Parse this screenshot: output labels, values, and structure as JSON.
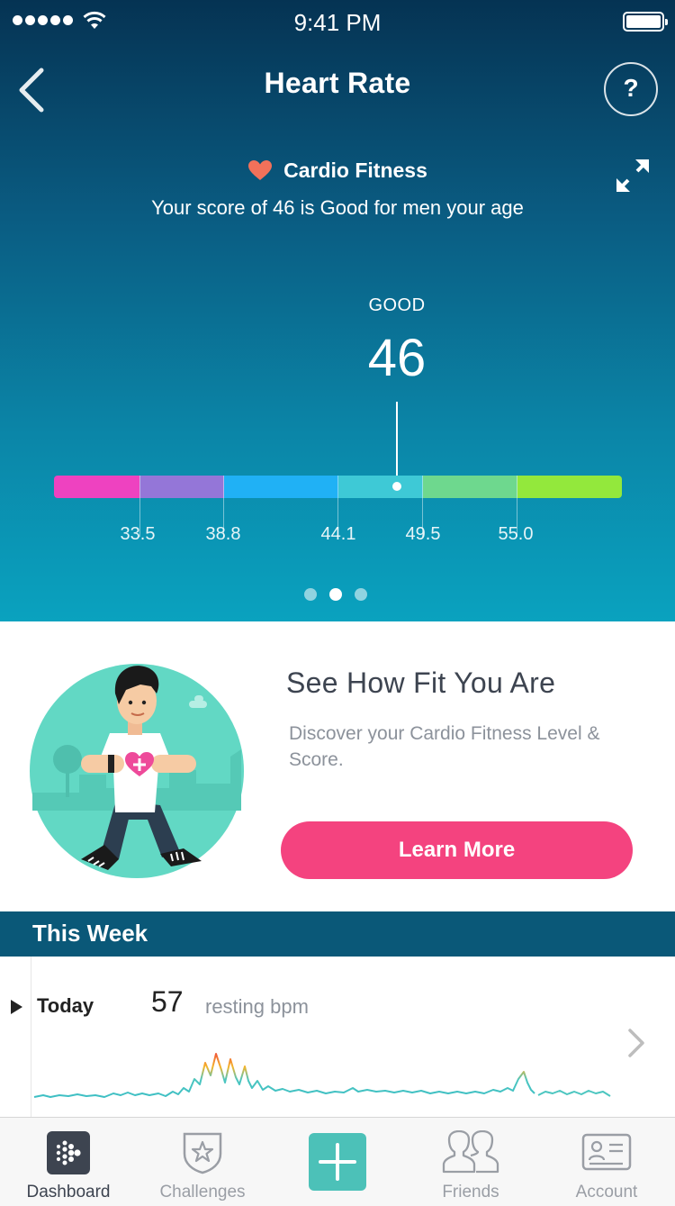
{
  "status_bar": {
    "time": "9:41 PM"
  },
  "header": {
    "title": "Heart Rate",
    "help_label": "?"
  },
  "cardio": {
    "title": "Cardio Fitness",
    "subtitle": "Your score of 46 is Good for men your age",
    "score_label": "GOOD",
    "score": "46",
    "score_value": 46,
    "ticks": [
      "33.5",
      "38.8",
      "44.1",
      "49.5",
      "55.0"
    ],
    "segment_colors": [
      "#ee42c0",
      "#9476d8",
      "#20b1f5",
      "#3ec9d6",
      "#6ed88e",
      "#93e83c"
    ],
    "pager": {
      "count": 3,
      "active": 2
    }
  },
  "promo": {
    "title": "See How Fit You Are",
    "description": "Discover your Cardio Fitness Level & Score.",
    "button_label": "Learn More"
  },
  "week": {
    "header": "This Week",
    "rows": [
      {
        "day": "Today",
        "value": "57",
        "unit": "resting bpm"
      }
    ]
  },
  "tabs": [
    {
      "label": "Dashboard",
      "icon": "fitbit-logo-icon",
      "active": true
    },
    {
      "label": "Challenges",
      "icon": "star-badge-icon",
      "active": false
    },
    {
      "label": "",
      "icon": "plus-icon",
      "active": false
    },
    {
      "label": "Friends",
      "icon": "people-icon",
      "active": false
    },
    {
      "label": "Account",
      "icon": "id-card-icon",
      "active": false
    }
  ],
  "colors": {
    "accent_pink": "#f4437f",
    "section_header": "#0a5878",
    "add_button": "#4cc1b8",
    "heart": "#f2715a"
  }
}
